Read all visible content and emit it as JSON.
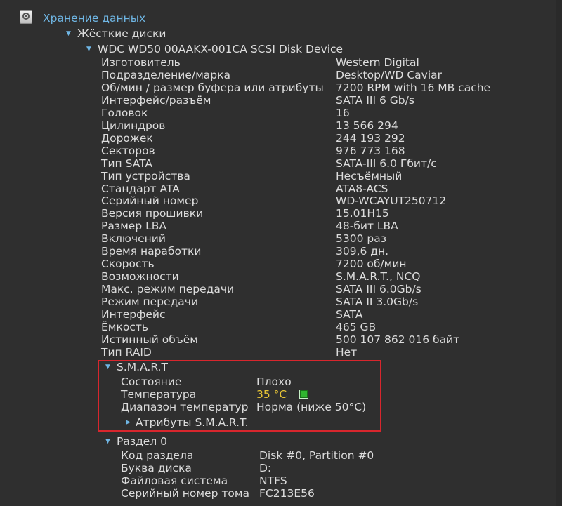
{
  "tree": {
    "storage_label": "Хранение данных",
    "hdd_label": "Жёсткие диски",
    "device_label": "WDC WD50 00AAKX-001CA SCSI Disk Device",
    "properties": [
      {
        "key": "Изготовитель",
        "value": "Western Digital"
      },
      {
        "key": "Подразделение/марка",
        "value": "Desktop/WD Caviar"
      },
      {
        "key": "Об/мин / размер буфера или атрибуты",
        "value": "7200 RPM with 16 MB cache"
      },
      {
        "key": "Интерфейс/разъём",
        "value": "SATA III 6 Gb/s"
      },
      {
        "key": "Головок",
        "value": "16"
      },
      {
        "key": "Цилиндров",
        "value": "13 566 294"
      },
      {
        "key": "Дорожек",
        "value": "244 193 292"
      },
      {
        "key": "Секторов",
        "value": "976 773 168"
      },
      {
        "key": "Тип SATA",
        "value": "SATA-III 6.0 Гбит/с"
      },
      {
        "key": "Тип устройства",
        "value": "Несъёмный"
      },
      {
        "key": "Стандарт ATA",
        "value": "ATA8-ACS"
      },
      {
        "key": "Серийный номер",
        "value": "WD-WCAYUT250712"
      },
      {
        "key": "Версия прошивки",
        "value": "15.01H15"
      },
      {
        "key": "Размер LBA",
        "value": "48-бит LBA"
      },
      {
        "key": "Включений",
        "value": "5300 раз"
      },
      {
        "key": "Время наработки",
        "value": "309,6 дн."
      },
      {
        "key": "Скорость",
        "value": "7200 об/мин"
      },
      {
        "key": "Возможности",
        "value": "S.M.A.R.T., NCQ"
      },
      {
        "key": "Макс. режим передачи",
        "value": "SATA III 6.0Gb/s"
      },
      {
        "key": "Режим передачи",
        "value": "SATA II 3.0Gb/s"
      },
      {
        "key": "Интерфейс",
        "value": "SATA"
      },
      {
        "key": "Ёмкость",
        "value": "465 GB"
      },
      {
        "key": "Истинный объём",
        "value": "500 107 862 016 байт"
      },
      {
        "key": "Тип RAID",
        "value": "Нет"
      }
    ],
    "smart": {
      "label": "S.M.A.R.T",
      "rows": [
        {
          "key": "Состояние",
          "value": "Плохо"
        },
        {
          "key": "Температура",
          "value": "35 °C"
        },
        {
          "key": "Диапазон температур",
          "value": "Норма (ниже 50°C)"
        }
      ],
      "attributes_label": "Атрибуты S.M.A.R.T.",
      "temperature_indicator_color": "#2fb52f",
      "highlight_color": "#d8262d"
    },
    "partition": {
      "label": "Раздел 0",
      "rows": [
        {
          "key": "Код раздела",
          "value": "Disk #0, Partition #0"
        },
        {
          "key": "Буква диска",
          "value": "D:"
        },
        {
          "key": "Файловая система",
          "value": "NTFS"
        },
        {
          "key": "Серийный номер тома",
          "value": "FC213E56"
        }
      ]
    }
  },
  "icons": {
    "storage": "hard-drive-icon",
    "expanded": "triangle-down-icon",
    "collapsed": "triangle-right-icon"
  },
  "colors": {
    "background": "#2f2f2f",
    "header_text": "#6fb6e4",
    "value_text": "#dcdcdc",
    "warning_text": "#e7c536"
  }
}
